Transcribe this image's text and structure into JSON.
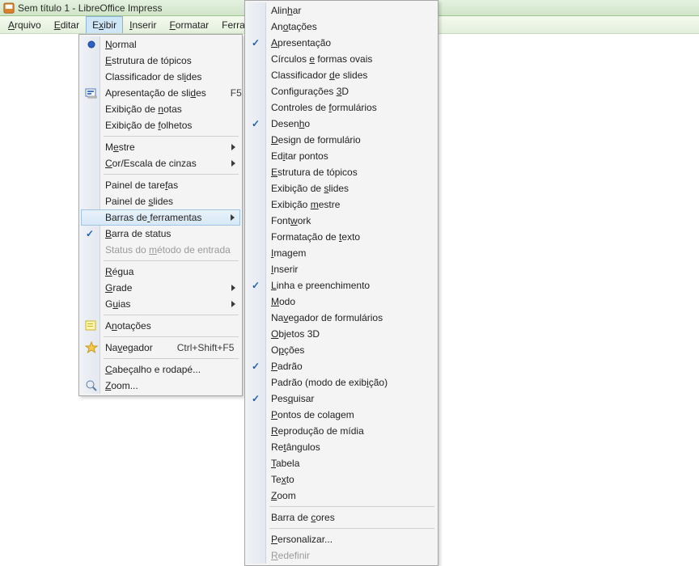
{
  "window": {
    "title": "Sem título 1 - LibreOffice Impress"
  },
  "menubar": {
    "items": [
      {
        "label": "Arquivo",
        "mn": 0
      },
      {
        "label": "Editar",
        "mn": 0
      },
      {
        "label": "Exibir",
        "mn": 1
      },
      {
        "label": "Inserir",
        "mn": 0
      },
      {
        "label": "Formatar",
        "mn": 0
      },
      {
        "label": "Ferramentas",
        "mn": -1
      }
    ],
    "open_index": 2
  },
  "exibir_menu": {
    "groups": [
      [
        {
          "label": "Normal",
          "mn": 0,
          "icon": "bullet-blue"
        },
        {
          "label": "Estrutura de tópicos",
          "mn": 0
        },
        {
          "label": "Classificador de slides",
          "ul_idx": 19
        },
        {
          "label": "Apresentação de slides",
          "ul_idx": 19,
          "icon": "slides",
          "accel": "F5"
        },
        {
          "label": "Exibição de notas",
          "mn": 12
        },
        {
          "label": "Exibição de folhetos",
          "mn": 12
        }
      ],
      [
        {
          "label": "Mestre",
          "mn": 1,
          "submenu": true
        },
        {
          "label": "Cor/Escala de cinzas",
          "mn": 0,
          "submenu": true
        }
      ],
      [
        {
          "label": "Painel de tarefas",
          "ul_idx": 14
        },
        {
          "label": "Painel de slides",
          "ul_idx": 10
        },
        {
          "label": "Barras de ferramentas",
          "mn": 9,
          "submenu": true,
          "highlight": true
        },
        {
          "label": "Barra de status",
          "mn": 0,
          "checked": true
        },
        {
          "label": "Status do método de entrada",
          "mn": 10,
          "disabled": true
        }
      ],
      [
        {
          "label": "Régua",
          "mn": 0
        },
        {
          "label": "Grade",
          "mn": 0,
          "submenu": true
        },
        {
          "label": "Guias",
          "mn": 1,
          "submenu": true
        }
      ],
      [
        {
          "label": "Anotações",
          "mn": 1,
          "icon": "note"
        }
      ],
      [
        {
          "label": "Navegador",
          "mn": 2,
          "icon": "star",
          "accel": "Ctrl+Shift+F5"
        }
      ],
      [
        {
          "label": "Cabeçalho e rodapé...",
          "mn": 0
        },
        {
          "label": "Zoom...",
          "mn": 0,
          "icon": "zoom"
        }
      ]
    ]
  },
  "toolbars_submenu": {
    "groups": [
      [
        {
          "label": "Alinhar",
          "mn": 4
        },
        {
          "label": "Anotações",
          "mn": 2
        },
        {
          "label": "Apresentação",
          "mn": 0,
          "checked": true
        },
        {
          "label": "Círculos e formas ovais",
          "mn": 9
        },
        {
          "label": "Classificador de slides",
          "mn": 14
        },
        {
          "label": "Configurações 3D",
          "mn": 14
        },
        {
          "label": "Controles de formulários",
          "mn": 13
        },
        {
          "label": "Desenho",
          "mn": 5,
          "checked": true
        },
        {
          "label": "Design de formulário",
          "mn": 0
        },
        {
          "label": "Editar pontos",
          "mn": 2
        },
        {
          "label": "Estrutura de tópicos",
          "mn": 0
        },
        {
          "label": "Exibição de slides",
          "mn": 12
        },
        {
          "label": "Exibição mestre",
          "mn": 9
        },
        {
          "label": "Fontwork",
          "mn": 4
        },
        {
          "label": "Formatação de texto",
          "mn": 14
        },
        {
          "label": "Imagem",
          "mn": 0
        },
        {
          "label": "Inserir",
          "mn": 0
        },
        {
          "label": "Linha e preenchimento",
          "mn": 0,
          "checked": true
        },
        {
          "label": "Modo",
          "mn": 0
        },
        {
          "label": "Navegador de formulários",
          "mn": 2
        },
        {
          "label": "Objetos 3D",
          "mn": 0
        },
        {
          "label": "Opções",
          "mn": 1
        },
        {
          "label": "Padrão",
          "mn": 0,
          "checked": true
        },
        {
          "label": "Padrão (modo de exibição)",
          "ul_idx": 20
        },
        {
          "label": "Pesquisar",
          "mn": 3,
          "checked": true
        },
        {
          "label": "Pontos de colagem",
          "mn": 0
        },
        {
          "label": "Reprodução de mídia",
          "mn": 0
        },
        {
          "label": "Retângulos",
          "mn": 2
        },
        {
          "label": "Tabela",
          "mn": 0
        },
        {
          "label": "Texto",
          "mn": 2
        },
        {
          "label": "Zoom",
          "mn": 0
        }
      ],
      [
        {
          "label": "Barra de cores",
          "mn": 9
        }
      ],
      [
        {
          "label": "Personalizar...",
          "mn": 0
        },
        {
          "label": "Redefinir",
          "mn": 0,
          "disabled": true
        }
      ]
    ]
  }
}
